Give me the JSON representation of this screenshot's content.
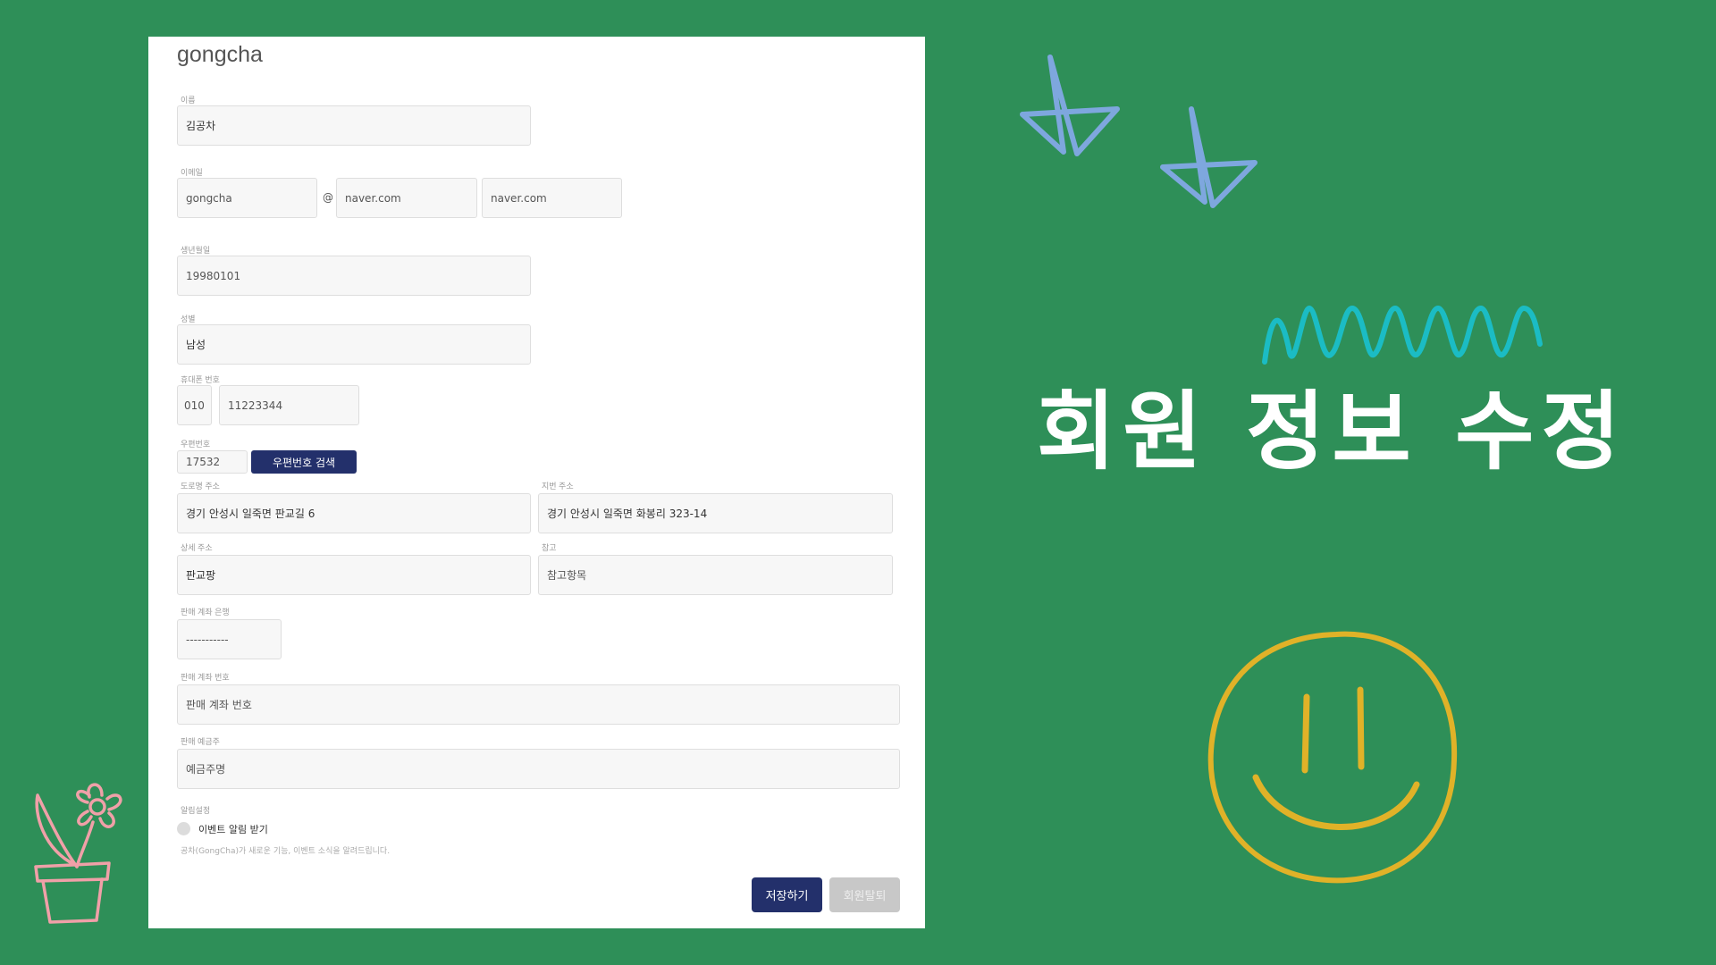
{
  "brand": "gongcha",
  "form": {
    "name": {
      "label": "이름",
      "value": "김공차"
    },
    "email": {
      "label": "이메일",
      "id": "gongcha",
      "at": "@",
      "domain": "naver.com",
      "domain_select": "naver.com"
    },
    "birth": {
      "label": "생년월일",
      "value": "19980101"
    },
    "gender": {
      "label": "성별",
      "value": "남성"
    },
    "phone": {
      "label": "휴대폰 번호",
      "prefix": "010",
      "number": "11223344"
    },
    "zipcode": {
      "label": "우편번호",
      "value": "17532",
      "search_button": "우편번호 검색"
    },
    "road_address": {
      "label": "도로명 주소",
      "value": "경기 안성시 일죽면 판교길 6"
    },
    "jibun_address": {
      "label": "지번 주소",
      "value": "경기 안성시 일죽면 화봉리 323-14"
    },
    "detail_address": {
      "label": "상세 주소",
      "value": "판교팡"
    },
    "reference": {
      "label": "참고",
      "placeholder": "참고항목"
    },
    "bank": {
      "label": "판매 계좌 은행",
      "value": "-----------"
    },
    "account_number": {
      "label": "판매 계좌 번호",
      "placeholder": "판매 계좌 번호"
    },
    "account_holder": {
      "label": "판매 예금주",
      "placeholder": "예금주명"
    },
    "marketing": {
      "label": "알림설정",
      "option": "이벤트 알림 받기",
      "notice": "공차(GongCha)가 새로운 기능, 이벤트 소식을 알려드립니다."
    }
  },
  "buttons": {
    "save": "저장하기",
    "withdraw": "회원탈퇴"
  },
  "hero_title": "회원 정보 수정",
  "colors": {
    "background": "#2e8f58",
    "primary_button": "#23306b",
    "stars": "#7ea7de",
    "zigzag": "#1bbcc4",
    "smiley": "#e0b228",
    "flower": "#f0a0a8"
  }
}
